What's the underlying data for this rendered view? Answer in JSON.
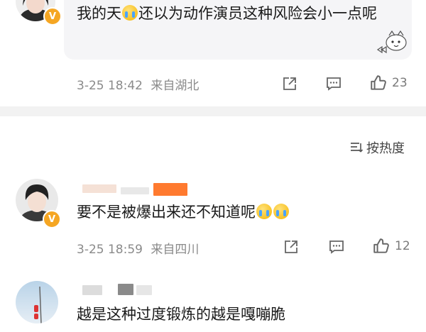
{
  "comments": [
    {
      "text_before_emoji": "我的天",
      "text_after_emoji": "还以为动作演员这种风险会小一点呢",
      "time": "3-25 18:42",
      "location": "来自湖北",
      "like_count": "23",
      "emoji": "crying-face"
    },
    {
      "text": "要不是被爆出来还不知道呢",
      "time": "3-25 18:59",
      "location": "来自四川",
      "like_count": "12",
      "emoji": "crying-face"
    },
    {
      "text": "越是这种过度锻炼的越是嘎嘣脆"
    }
  ],
  "sort": {
    "label": "按热度",
    "icon": "sort-icon"
  },
  "icons": {
    "share": "share-icon",
    "comment": "comment-icon",
    "like": "thumbs-up-icon",
    "verified": "verified-badge-icon"
  },
  "colors": {
    "badge": "#f5a623",
    "meta_text": "#8a8a8a",
    "bubble_bg": "#f5f5f7",
    "divider": "#f2f2f2",
    "censor_orange": "#ff7a2f"
  }
}
